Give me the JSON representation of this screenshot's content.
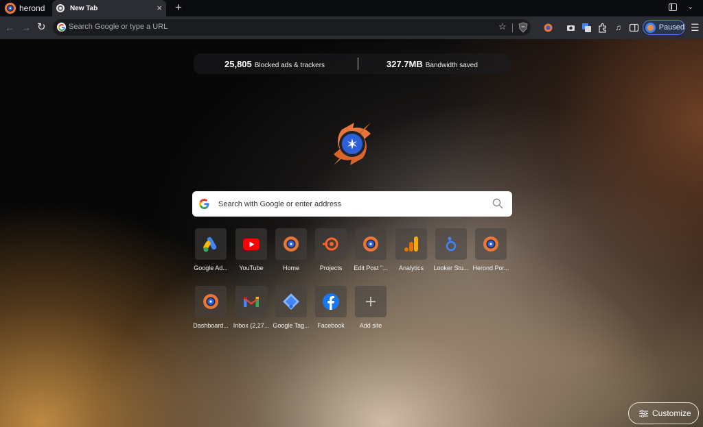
{
  "browser": {
    "brand_name": "herond",
    "tab": {
      "title": "New Tab",
      "close_glyph": "×"
    },
    "new_tab_glyph": "+",
    "omnibox": {
      "placeholder": "Search Google or type a URL"
    },
    "profile": {
      "status": "Paused"
    }
  },
  "stats": {
    "blocked": {
      "value": "25,805",
      "label": "Blocked ads & trackers"
    },
    "bandwidth": {
      "value": "327.7MB",
      "label": "Bandwidth saved"
    }
  },
  "search": {
    "placeholder": "Search with Google or enter address"
  },
  "tiles": [
    {
      "label": "Google Ad...",
      "icon": "google-ads-icon"
    },
    {
      "label": "YouTube",
      "icon": "youtube-icon"
    },
    {
      "label": "Home",
      "icon": "herond-icon"
    },
    {
      "label": "Projects",
      "icon": "semrush-icon"
    },
    {
      "label": "Edit Post \"...",
      "icon": "herond-icon"
    },
    {
      "label": "Analytics",
      "icon": "google-analytics-icon"
    },
    {
      "label": "Looker Stu...",
      "icon": "looker-studio-icon"
    },
    {
      "label": "Herond Por...",
      "icon": "herond-icon"
    },
    {
      "label": "Dashboard...",
      "icon": "herond-icon"
    },
    {
      "label": "Inbox (2,27...",
      "icon": "gmail-icon"
    },
    {
      "label": "Google Tag...",
      "icon": "google-tag-manager-icon"
    },
    {
      "label": "Facebook",
      "icon": "facebook-icon"
    },
    {
      "label": "Add site",
      "icon": "plus-icon"
    }
  ],
  "customize": {
    "label": "Customize"
  },
  "colors": {
    "herond_orange": "#e8763a",
    "herond_blue": "#2f5fd8",
    "profile_border": "#4f7ce6",
    "youtube_red": "#ff0000",
    "facebook_blue": "#1877f2"
  }
}
